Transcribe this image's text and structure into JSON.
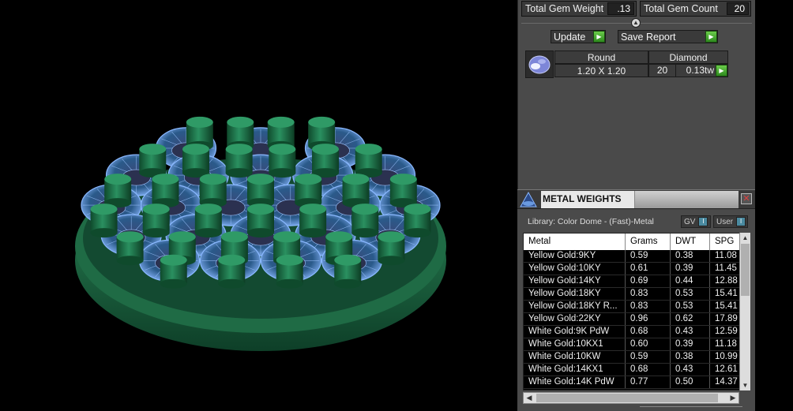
{
  "totals": {
    "gem_weight_label": "Total Gem Weight",
    "gem_weight_value": ".13",
    "gem_count_label": "Total Gem Count",
    "gem_count_value": "20"
  },
  "actions": {
    "update_label": "Update",
    "save_report_label": "Save Report"
  },
  "gem": {
    "shape": "Round",
    "type": "Diamond",
    "size": "1.20 X 1.20",
    "count": "20",
    "tw": "0.13tw"
  },
  "metal_weights": {
    "title": "METAL WEIGHTS",
    "library": "Library: Color Dome - (Fast)-Metal",
    "toggle_gv": "GV",
    "toggle_user": "User",
    "columns": [
      "Metal",
      "Grams",
      "DWT",
      "SPG"
    ],
    "rows": [
      [
        "Yellow Gold:9KY",
        "0.59",
        "0.38",
        "11.08"
      ],
      [
        "Yellow Gold:10KY",
        "0.61",
        "0.39",
        "11.45"
      ],
      [
        "Yellow Gold:14KY",
        "0.69",
        "0.44",
        "12.88"
      ],
      [
        "Yellow Gold:18KY",
        "0.83",
        "0.53",
        "15.41"
      ],
      [
        "Yellow Gold:18KY R...",
        "0.83",
        "0.53",
        "15.41"
      ],
      [
        "Yellow Gold:22KY",
        "0.96",
        "0.62",
        "17.89"
      ],
      [
        "White Gold:9K PdW",
        "0.68",
        "0.43",
        "12.59"
      ],
      [
        "White Gold:10KX1",
        "0.60",
        "0.39",
        "11.18"
      ],
      [
        "White Gold:10KW",
        "0.59",
        "0.38",
        "10.99"
      ],
      [
        "White Gold:14KX1",
        "0.68",
        "0.43",
        "12.61"
      ],
      [
        "White Gold:14K PdW",
        "0.77",
        "0.50",
        "14.37"
      ]
    ]
  },
  "colors": {
    "metal_green": "#1f6b45",
    "gem_blue": "#8ab8ff",
    "panel_bg": "#4a4a4a",
    "accent_green": "#4caf30"
  },
  "icons": {
    "gem_thumb": "round-diamond-icon",
    "logo": "triangle-logo-icon",
    "close": "close-icon",
    "arrow": "play-arrow-icon",
    "collapse": "chevron-up-icon"
  }
}
